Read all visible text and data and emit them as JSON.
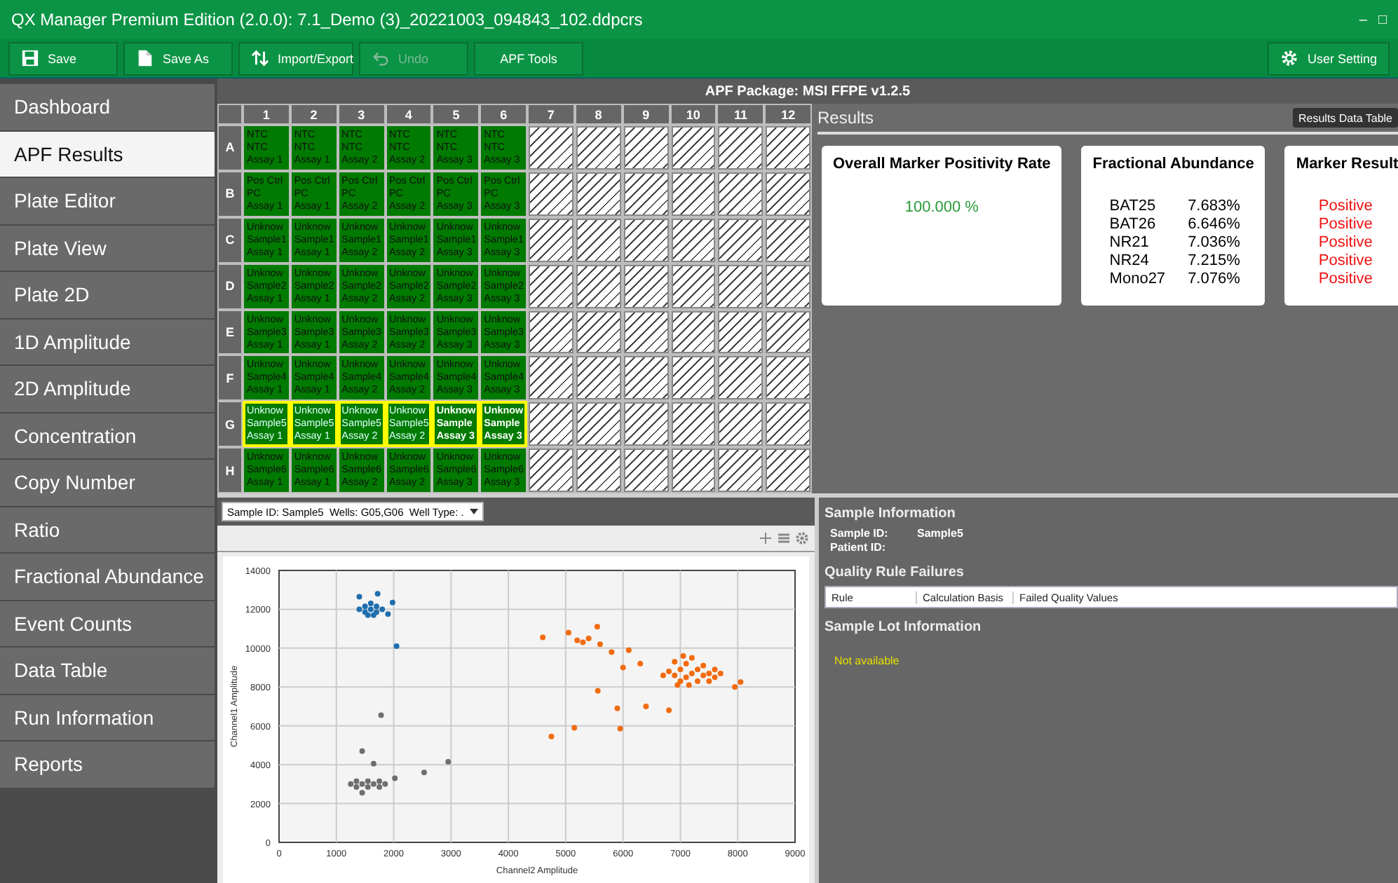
{
  "window": {
    "title": "QX Manager Premium Edition (2.0.0): 7.1_Demo (3)_20221003_094843_102.ddpcrs",
    "controls": [
      "–",
      "□"
    ]
  },
  "toolbar": [
    {
      "kind": "save",
      "label": "Save",
      "disabled": false
    },
    {
      "kind": "saveas",
      "label": "Save As",
      "disabled": false
    },
    {
      "kind": "importexport",
      "label": "Import/Export",
      "disabled": false
    },
    {
      "kind": "undo",
      "label": "Undo",
      "disabled": true
    },
    {
      "kind": "plain",
      "label": "APF Tools",
      "disabled": false
    },
    {
      "kind": "settings",
      "label": "User Setting",
      "disabled": false
    }
  ],
  "sidebar": {
    "items": [
      {
        "label": "Dashboard",
        "selected": false
      },
      {
        "label": "APF Results",
        "selected": true
      },
      {
        "label": "Plate Editor",
        "selected": false
      },
      {
        "label": "Plate View",
        "selected": false
      },
      {
        "label": "Plate 2D",
        "selected": false
      },
      {
        "label": "1D Amplitude",
        "selected": false
      },
      {
        "label": "2D Amplitude",
        "selected": false
      },
      {
        "label": "Concentration",
        "selected": false
      },
      {
        "label": "Copy Number",
        "selected": false
      },
      {
        "label": "Ratio",
        "selected": false
      },
      {
        "label": "Fractional Abundance",
        "selected": false
      },
      {
        "label": "Event Counts",
        "selected": false
      },
      {
        "label": "Data Table",
        "selected": false
      },
      {
        "label": "Run Information",
        "selected": false
      },
      {
        "label": "Reports",
        "selected": false
      }
    ]
  },
  "package_title": "APF Package: MSI FFPE v1.2.5",
  "plate": {
    "columns": [
      "1",
      "2",
      "3",
      "4",
      "5",
      "6",
      "7",
      "8",
      "9",
      "10",
      "11",
      "12"
    ],
    "rows": [
      {
        "label": "A",
        "wells": [
          {
            "kind": "sample",
            "lines": [
              "NTC",
              "NTC",
              "Assay 1"
            ],
            "selected": false,
            "current": false
          },
          {
            "kind": "sample",
            "lines": [
              "NTC",
              "NTC",
              "Assay 1"
            ],
            "selected": false,
            "current": false
          },
          {
            "kind": "sample",
            "lines": [
              "NTC",
              "NTC",
              "Assay 2"
            ],
            "selected": false,
            "current": false
          },
          {
            "kind": "sample",
            "lines": [
              "NTC",
              "NTC",
              "Assay 2"
            ],
            "selected": false,
            "current": false
          },
          {
            "kind": "sample",
            "lines": [
              "NTC",
              "NTC",
              "Assay 3"
            ],
            "selected": false,
            "current": false
          },
          {
            "kind": "sample",
            "lines": [
              "NTC",
              "NTC",
              "Assay 3"
            ],
            "selected": false,
            "current": false
          },
          {
            "kind": "empty",
            "selected": false
          },
          {
            "kind": "empty",
            "selected": false
          },
          {
            "kind": "empty",
            "selected": false
          },
          {
            "kind": "empty",
            "selected": false
          },
          {
            "kind": "empty",
            "selected": false
          },
          {
            "kind": "empty",
            "selected": false
          }
        ]
      },
      {
        "label": "B",
        "wells": [
          {
            "kind": "sample",
            "lines": [
              "Pos Ctrl",
              "PC",
              "Assay 1"
            ],
            "selected": false,
            "current": false
          },
          {
            "kind": "sample",
            "lines": [
              "Pos Ctrl",
              "PC",
              "Assay 1"
            ],
            "selected": false,
            "current": false
          },
          {
            "kind": "sample",
            "lines": [
              "Pos Ctrl",
              "PC",
              "Assay 2"
            ],
            "selected": false,
            "current": false
          },
          {
            "kind": "sample",
            "lines": [
              "Pos Ctrl",
              "PC",
              "Assay 2"
            ],
            "selected": false,
            "current": false
          },
          {
            "kind": "sample",
            "lines": [
              "Pos Ctrl",
              "PC",
              "Assay 3"
            ],
            "selected": false,
            "current": false
          },
          {
            "kind": "sample",
            "lines": [
              "Pos Ctrl",
              "PC",
              "Assay 3"
            ],
            "selected": false,
            "current": false
          },
          {
            "kind": "empty",
            "selected": false
          },
          {
            "kind": "empty",
            "selected": false
          },
          {
            "kind": "empty",
            "selected": false
          },
          {
            "kind": "empty",
            "selected": false
          },
          {
            "kind": "empty",
            "selected": false
          },
          {
            "kind": "empty",
            "selected": false
          }
        ]
      },
      {
        "label": "C",
        "wells": [
          {
            "kind": "sample",
            "lines": [
              "Unknow",
              "Sample1",
              "Assay 1"
            ],
            "selected": false,
            "current": false
          },
          {
            "kind": "sample",
            "lines": [
              "Unknow",
              "Sample1",
              "Assay 1"
            ],
            "selected": false,
            "current": false
          },
          {
            "kind": "sample",
            "lines": [
              "Unknow",
              "Sample1",
              "Assay 2"
            ],
            "selected": false,
            "current": false
          },
          {
            "kind": "sample",
            "lines": [
              "Unknow",
              "Sample1",
              "Assay 2"
            ],
            "selected": false,
            "current": false
          },
          {
            "kind": "sample",
            "lines": [
              "Unknow",
              "Sample1",
              "Assay 3"
            ],
            "selected": false,
            "current": false
          },
          {
            "kind": "sample",
            "lines": [
              "Unknow",
              "Sample1",
              "Assay 3"
            ],
            "selected": false,
            "current": false
          },
          {
            "kind": "empty",
            "selected": false
          },
          {
            "kind": "empty",
            "selected": false
          },
          {
            "kind": "empty",
            "selected": false
          },
          {
            "kind": "empty",
            "selected": false
          },
          {
            "kind": "empty",
            "selected": false
          },
          {
            "kind": "empty",
            "selected": false
          }
        ]
      },
      {
        "label": "D",
        "wells": [
          {
            "kind": "sample",
            "lines": [
              "Unknow",
              "Sample2",
              "Assay 1"
            ],
            "selected": false,
            "current": false
          },
          {
            "kind": "sample",
            "lines": [
              "Unknow",
              "Sample2",
              "Assay 1"
            ],
            "selected": false,
            "current": false
          },
          {
            "kind": "sample",
            "lines": [
              "Unknow",
              "Sample2",
              "Assay 2"
            ],
            "selected": false,
            "current": false
          },
          {
            "kind": "sample",
            "lines": [
              "Unknow",
              "Sample2",
              "Assay 2"
            ],
            "selected": false,
            "current": false
          },
          {
            "kind": "sample",
            "lines": [
              "Unknow",
              "Sample2",
              "Assay 3"
            ],
            "selected": false,
            "current": false
          },
          {
            "kind": "sample",
            "lines": [
              "Unknow",
              "Sample2",
              "Assay 3"
            ],
            "selected": false,
            "current": false
          },
          {
            "kind": "empty",
            "selected": false
          },
          {
            "kind": "empty",
            "selected": false
          },
          {
            "kind": "empty",
            "selected": false
          },
          {
            "kind": "empty",
            "selected": false
          },
          {
            "kind": "empty",
            "selected": false
          },
          {
            "kind": "empty",
            "selected": false
          }
        ]
      },
      {
        "label": "E",
        "wells": [
          {
            "kind": "sample",
            "lines": [
              "Unknow",
              "Sample3",
              "Assay 1"
            ],
            "selected": false,
            "current": false
          },
          {
            "kind": "sample",
            "lines": [
              "Unknow",
              "Sample3",
              "Assay 1"
            ],
            "selected": false,
            "current": false
          },
          {
            "kind": "sample",
            "lines": [
              "Unknow",
              "Sample3",
              "Assay 2"
            ],
            "selected": false,
            "current": false
          },
          {
            "kind": "sample",
            "lines": [
              "Unknow",
              "Sample3",
              "Assay 2"
            ],
            "selected": false,
            "current": false
          },
          {
            "kind": "sample",
            "lines": [
              "Unknow",
              "Sample3",
              "Assay 3"
            ],
            "selected": false,
            "current": false
          },
          {
            "kind": "sample",
            "lines": [
              "Unknow",
              "Sample3",
              "Assay 3"
            ],
            "selected": false,
            "current": false
          },
          {
            "kind": "empty",
            "selected": false
          },
          {
            "kind": "empty",
            "selected": false
          },
          {
            "kind": "empty",
            "selected": false
          },
          {
            "kind": "empty",
            "selected": false
          },
          {
            "kind": "empty",
            "selected": false
          },
          {
            "kind": "empty",
            "selected": false
          }
        ]
      },
      {
        "label": "F",
        "wells": [
          {
            "kind": "sample",
            "lines": [
              "Unknow",
              "Sample4",
              "Assay 1"
            ],
            "selected": false,
            "current": false
          },
          {
            "kind": "sample",
            "lines": [
              "Unknow",
              "Sample4",
              "Assay 1"
            ],
            "selected": false,
            "current": false
          },
          {
            "kind": "sample",
            "lines": [
              "Unknow",
              "Sample4",
              "Assay 2"
            ],
            "selected": false,
            "current": false
          },
          {
            "kind": "sample",
            "lines": [
              "Unknow",
              "Sample4",
              "Assay 2"
            ],
            "selected": false,
            "current": false
          },
          {
            "kind": "sample",
            "lines": [
              "Unknow",
              "Sample4",
              "Assay 3"
            ],
            "selected": false,
            "current": false
          },
          {
            "kind": "sample",
            "lines": [
              "Unknow",
              "Sample4",
              "Assay 3"
            ],
            "selected": false,
            "current": false
          },
          {
            "kind": "empty",
            "selected": false
          },
          {
            "kind": "empty",
            "selected": false
          },
          {
            "kind": "empty",
            "selected": false
          },
          {
            "kind": "empty",
            "selected": false
          },
          {
            "kind": "empty",
            "selected": false
          },
          {
            "kind": "empty",
            "selected": false
          }
        ]
      },
      {
        "label": "G",
        "wells": [
          {
            "kind": "sample",
            "lines": [
              "Unknow",
              "Sample5",
              "Assay 1"
            ],
            "selected": true,
            "current": false
          },
          {
            "kind": "sample",
            "lines": [
              "Unknow",
              "Sample5",
              "Assay 1"
            ],
            "selected": true,
            "current": false
          },
          {
            "kind": "sample",
            "lines": [
              "Unknow",
              "Sample5",
              "Assay 2"
            ],
            "selected": true,
            "current": false
          },
          {
            "kind": "sample",
            "lines": [
              "Unknow",
              "Sample5",
              "Assay 2"
            ],
            "selected": true,
            "current": false
          },
          {
            "kind": "sample",
            "lines": [
              "Unknow",
              "Sample",
              "Assay 3"
            ],
            "selected": true,
            "current": true
          },
          {
            "kind": "sample",
            "lines": [
              "Unknow",
              "Sample",
              "Assay 3"
            ],
            "selected": true,
            "current": true
          },
          {
            "kind": "empty",
            "selected": false
          },
          {
            "kind": "empty",
            "selected": false
          },
          {
            "kind": "empty",
            "selected": false
          },
          {
            "kind": "empty",
            "selected": false
          },
          {
            "kind": "empty",
            "selected": false
          },
          {
            "kind": "empty",
            "selected": false
          }
        ]
      },
      {
        "label": "H",
        "wells": [
          {
            "kind": "sample",
            "lines": [
              "Unknow",
              "Sample6",
              "Assay 1"
            ],
            "selected": false,
            "current": false
          },
          {
            "kind": "sample",
            "lines": [
              "Unknow",
              "Sample6",
              "Assay 1"
            ],
            "selected": false,
            "current": false
          },
          {
            "kind": "sample",
            "lines": [
              "Unknow",
              "Sample6",
              "Assay 2"
            ],
            "selected": false,
            "current": false
          },
          {
            "kind": "sample",
            "lines": [
              "Unknow",
              "Sample6",
              "Assay 2"
            ],
            "selected": false,
            "current": false
          },
          {
            "kind": "sample",
            "lines": [
              "Unknow",
              "Sample6",
              "Assay 3"
            ],
            "selected": false,
            "current": false
          },
          {
            "kind": "sample",
            "lines": [
              "Unknow",
              "Sample6",
              "Assay 3"
            ],
            "selected": false,
            "current": false
          },
          {
            "kind": "empty",
            "selected": false
          },
          {
            "kind": "empty",
            "selected": false
          },
          {
            "kind": "empty",
            "selected": false
          },
          {
            "kind": "empty",
            "selected": false
          },
          {
            "kind": "empty",
            "selected": false
          },
          {
            "kind": "empty",
            "selected": false
          }
        ]
      }
    ]
  },
  "results": {
    "title": "Results",
    "button": "Results Data Table",
    "cards": [
      {
        "kind": "rate",
        "title": "Overall Marker Positivity Rate",
        "value": "100.000 %"
      },
      {
        "kind": "table",
        "title": "Fractional Abundance",
        "rows": [
          [
            "BAT25",
            "7.683%"
          ],
          [
            "BAT26",
            "6.646%"
          ],
          [
            "NR21",
            "7.036%"
          ],
          [
            "NR24",
            "7.215%"
          ],
          [
            "Mono27",
            "7.076%"
          ]
        ]
      },
      {
        "kind": "list",
        "title": "Marker Result",
        "items": [
          "Positive",
          "Positive",
          "Positive",
          "Positive",
          "Positive"
        ]
      }
    ]
  },
  "sample_selector": {
    "value": "Sample ID: Sample5  Wells: G05,G06  Well Type: ."
  },
  "chart": {
    "chart_data": {
      "type": "scatter",
      "grid": true,
      "xlabel": "Channel2 Amplitude",
      "ylabel": "Channel1 Amplitude",
      "xlim": [
        0,
        9000
      ],
      "ylim": [
        0,
        14000
      ],
      "xticks": [
        0,
        1000,
        2000,
        3000,
        4000,
        5000,
        6000,
        7000,
        8000,
        9000
      ],
      "yticks": [
        0,
        2000,
        4000,
        6000,
        8000,
        10000,
        12000,
        14000
      ],
      "series": [
        {
          "color": "#1f6fae",
          "x": [
            1400,
            1500,
            1500,
            1600,
            1600,
            1700,
            1700,
            1800,
            1550,
            1650,
            1400,
            1720,
            1980,
            2050,
            1900
          ],
          "values": [
            12000,
            11850,
            12150,
            12000,
            12300,
            11850,
            12150,
            12000,
            11700,
            11700,
            12650,
            12800,
            12350,
            10100,
            11750
          ]
        },
        {
          "color": "#6e6e6e",
          "x": [
            1250,
            1350,
            1350,
            1450,
            1550,
            1550,
            1650,
            1750,
            1750,
            1850,
            1450,
            1650,
            1780,
            2020,
            2530,
            2950,
            1450
          ],
          "values": [
            3000,
            2850,
            3150,
            3000,
            2850,
            3150,
            3000,
            2850,
            3150,
            3000,
            4700,
            4050,
            6550,
            3300,
            3600,
            4150,
            2550
          ]
        },
        {
          "color": "#f26b0f",
          "x": [
            6800,
            6900,
            7000,
            7100,
            7200,
            7300,
            7400,
            7500,
            7600,
            7000,
            7100,
            7200,
            7300,
            6700,
            7600,
            7700,
            6900,
            7400,
            7150,
            6950,
            7050,
            7500,
            4600,
            5050,
            5200,
            5300,
            5400,
            5550,
            5600,
            5800,
            6100,
            6300,
            6000,
            5560,
            6400,
            6800,
            5900,
            5150,
            5950,
            4750,
            8050,
            7950
          ],
          "values": [
            8800,
            8600,
            8900,
            8500,
            8700,
            8900,
            8600,
            8700,
            8500,
            8300,
            9200,
            9500,
            8300,
            8600,
            8900,
            8700,
            9300,
            9100,
            8100,
            8100,
            9600,
            8300,
            10550,
            10800,
            10400,
            10300,
            10500,
            11100,
            10200,
            9800,
            9900,
            9200,
            9000,
            7800,
            7000,
            6800,
            6900,
            5900,
            5850,
            5450,
            8250,
            8000
          ]
        }
      ]
    }
  },
  "sample_info": {
    "title": "Sample Information",
    "fields": [
      {
        "label": "Sample ID:",
        "value": "Sample5"
      },
      {
        "label": "Patient ID:"
      }
    ]
  },
  "quality": {
    "title": "Quality Rule Failures",
    "columns": [
      "Rule",
      "Calculation Basis",
      "Failed Quality Values"
    ]
  },
  "lot": {
    "title": "Sample Lot Information",
    "message": "Not available"
  }
}
